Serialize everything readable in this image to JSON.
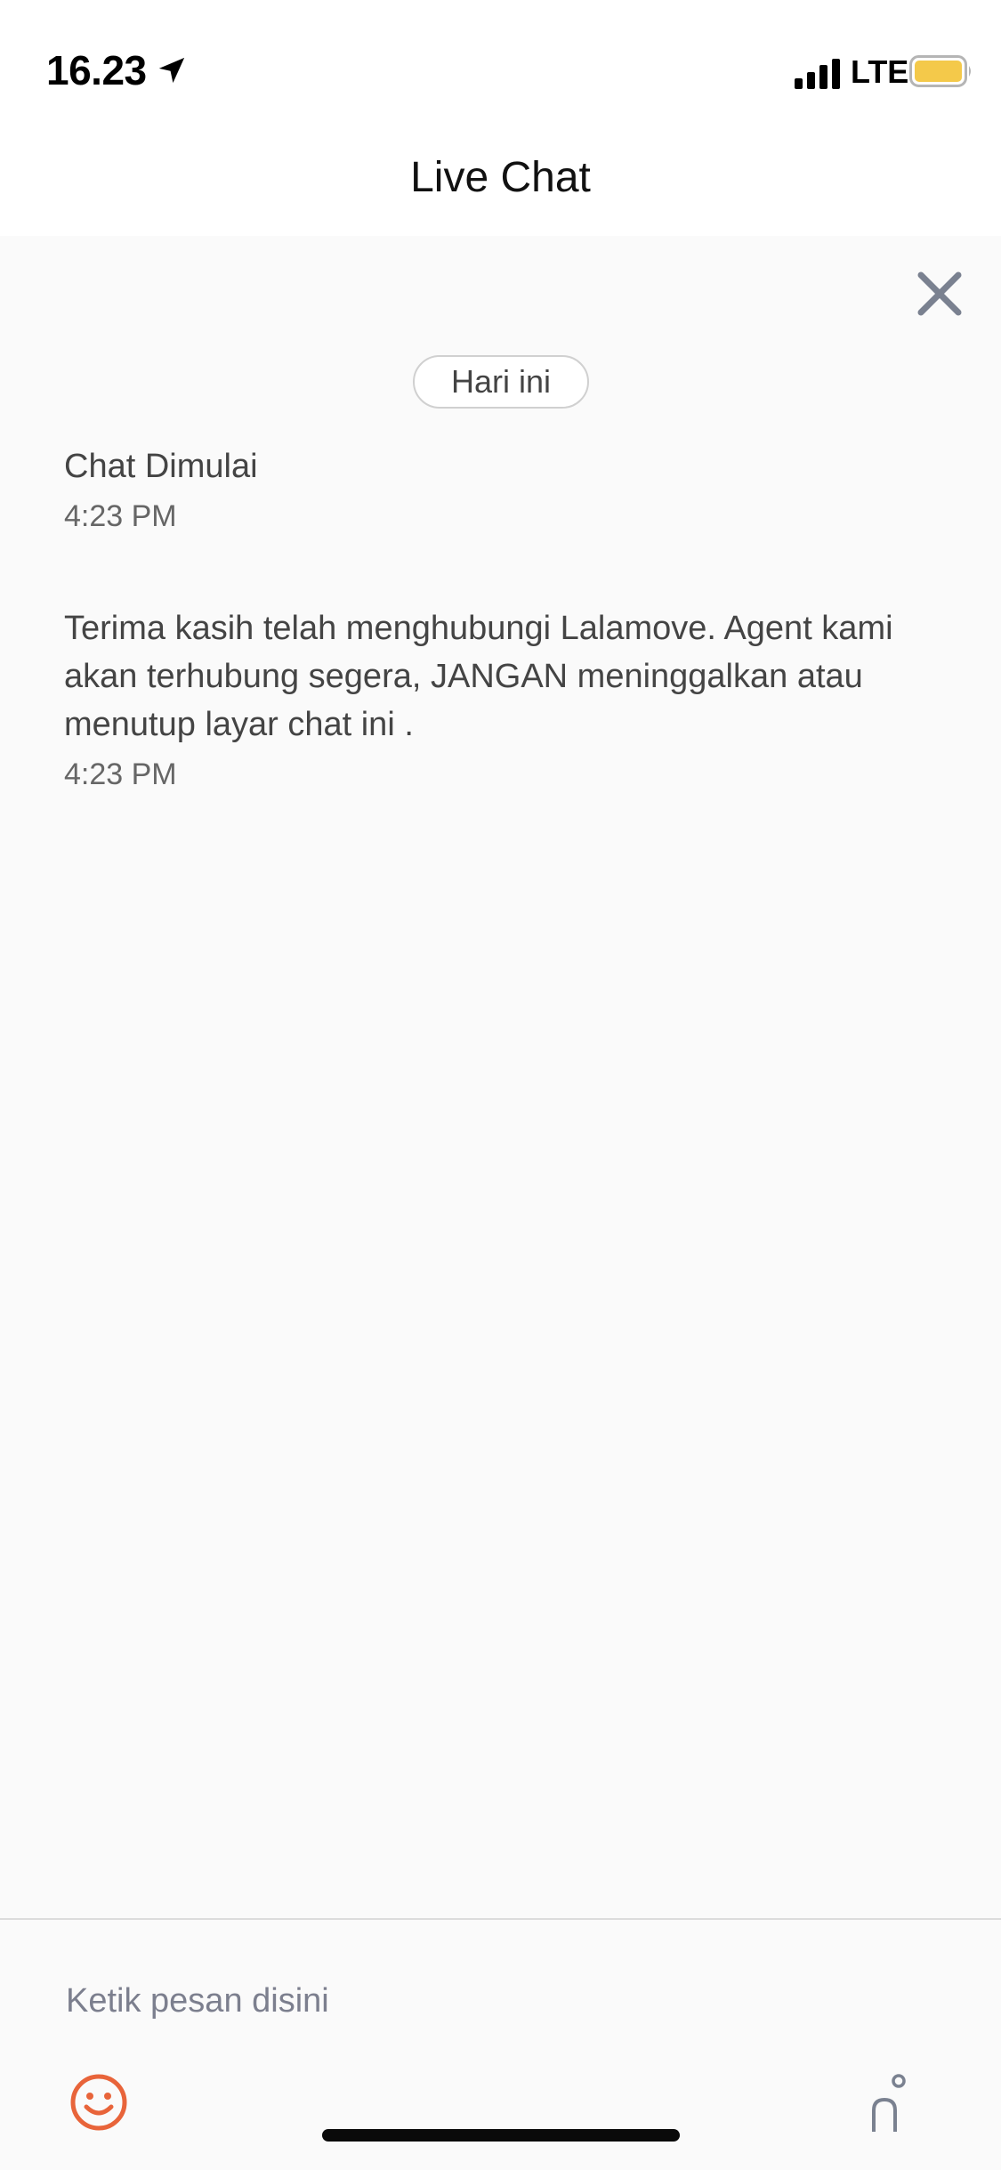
{
  "status_bar": {
    "time": "16.23",
    "network": "LTE",
    "icons": [
      "location-arrow-icon",
      "signal-icon",
      "battery-icon"
    ],
    "battery_color": "#F4C94A"
  },
  "header": {
    "title": "Live Chat"
  },
  "chat": {
    "close_icon": "close-icon",
    "date_label": "Hari ini",
    "messages": [
      {
        "text": "Chat Dimulai",
        "time": "4:23 PM"
      },
      {
        "text": "Terima kasih telah menghubungi Lalamove. Agent kami akan terhubung segera, JANGAN meninggalkan atau menutup layar chat ini .",
        "time": "4:23 PM"
      }
    ]
  },
  "composer": {
    "placeholder": "Ketik pesan disini",
    "emoji_icon": "emoji-icon",
    "attach_icon": "attach-icon",
    "accent_color": "#E8643A"
  }
}
